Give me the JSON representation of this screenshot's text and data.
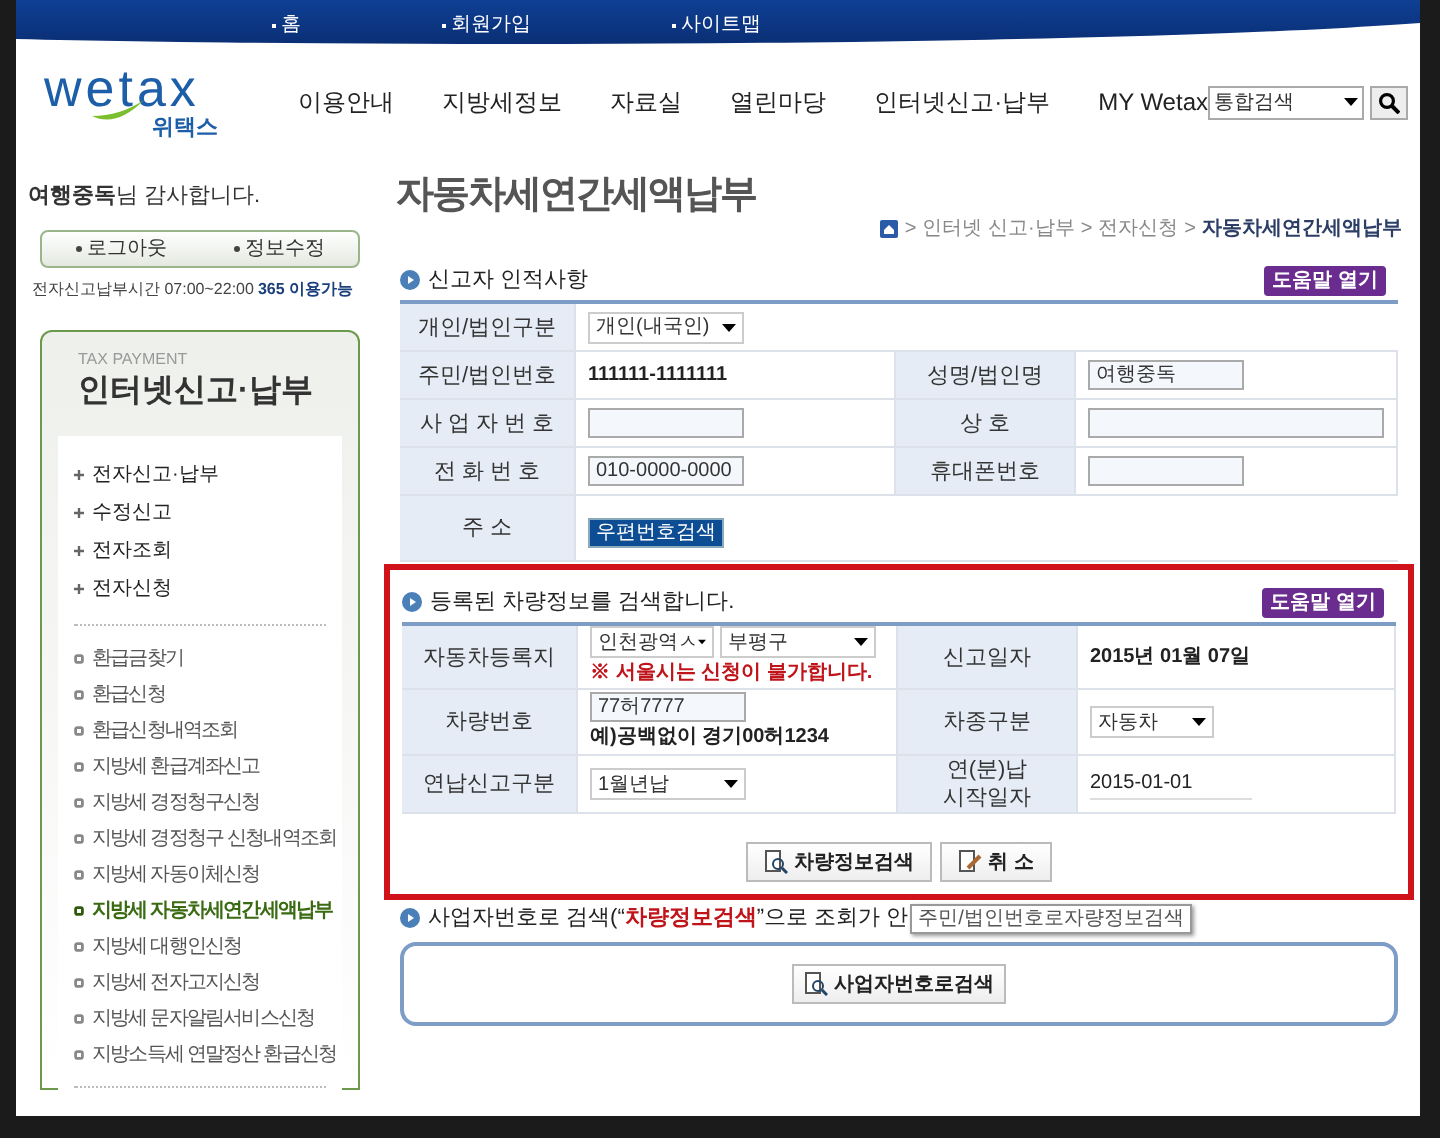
{
  "top_links": [
    "홈",
    "회원가입",
    "사이트맵"
  ],
  "logo": {
    "text": "wetax",
    "subtitle": "위택스"
  },
  "nav": [
    "이용안내",
    "지방세정보",
    "자료실",
    "열린마당",
    "인터넷신고·납부",
    "MY Wetax"
  ],
  "search": {
    "scope": "통합검색"
  },
  "user": {
    "greeting": "**여행중독**님 감사합니다.",
    "buttons": [
      "로그아웃",
      "정보수정"
    ],
    "hours": "전자신고납부시간 07:00~22:00",
    "hours_note": "365 이용가능"
  },
  "sidebar": {
    "eyebrow": "TAX PAYMENT",
    "title": "인터넷신고·납부",
    "groups": [
      "전자신고·납부",
      "수정신고",
      "전자조회",
      "전자신청"
    ],
    "items": [
      {
        "label": "환급금찾기",
        "selected": false
      },
      {
        "label": "환급신청",
        "selected": false
      },
      {
        "label": "환급신청내역조회",
        "selected": false
      },
      {
        "label": "지방세 환급계좌신고",
        "selected": false
      },
      {
        "label": "지방세 경정청구신청",
        "selected": false
      },
      {
        "label": "지방세 경정청구 신청내역조회",
        "selected": false
      },
      {
        "label": "지방세 자동이체신청",
        "selected": false
      },
      {
        "label": "지방세 자동차세연간세액납부",
        "selected": true
      },
      {
        "label": "지방세 대행인신청",
        "selected": false
      },
      {
        "label": "지방세 전자고지신청",
        "selected": false
      },
      {
        "label": "지방세 문자알림서비스신청",
        "selected": false
      },
      {
        "label": "지방소득세 연말정산 환급신청",
        "selected": false
      }
    ]
  },
  "page_title": "자동차세연간세액납부",
  "breadcrumb": {
    "separator": ">",
    "items": [
      "인터넷 신고·납부",
      "전자신청",
      "자동차세연간세액납부"
    ]
  },
  "reporter_section": {
    "title": "신고자 인적사항",
    "help": "도움말 열기",
    "rows": [
      [
        {
          "label": "개인/법인구분",
          "fields": [
            {
              "kind": "select",
              "value": "개인(내국인)"
            }
          ]
        }
      ],
      [
        {
          "label": "주민/법인번호",
          "fields": [
            {
              "kind": "text",
              "value": "111111-1111111"
            }
          ]
        },
        {
          "label": "성명/법인명",
          "fields": [
            {
              "kind": "input",
              "value": "여행중독"
            }
          ]
        }
      ],
      [
        {
          "label": "사 업 자 번 호",
          "fields": [
            {
              "kind": "input"
            }
          ]
        },
        {
          "label": "상 호",
          "fields": [
            {
              "kind": "input_wide"
            }
          ]
        }
      ],
      [
        {
          "label": "전 화 번 호",
          "fields": [
            {
              "kind": "input",
              "value": "010-0000-0000"
            }
          ]
        },
        {
          "label": "휴대폰번호",
          "fields": [
            {
              "kind": "input"
            }
          ]
        }
      ],
      [
        {
          "label": "주 소",
          "fields": [
            {
              "kind": "button",
              "value": "우편번호검색"
            }
          ]
        }
      ]
    ]
  },
  "vehicle_section": {
    "title": "등록된 차량정보를 검색합니다.",
    "help": "도움말 열기",
    "rows": [
      [
        {
          "label": "자동차등록지",
          "fields": [
            {
              "kind": "select_small",
              "value": "인천광역ㅅ"
            },
            {
              "kind": "select",
              "value": "부평구"
            },
            {
              "kind": "warning",
              "value": "※ 서울시는 신청이 불가합니다."
            }
          ]
        },
        {
          "label": "신고일자",
          "fields": [
            {
              "kind": "text",
              "value": "2015년 01월 07일"
            }
          ]
        }
      ],
      [
        {
          "label": "차량번호",
          "fields": [
            {
              "kind": "input",
              "value": "77허7777"
            },
            {
              "kind": "hint",
              "value": "예)공백없이 경기00허1234"
            }
          ]
        },
        {
          "label": "차종구분",
          "fields": [
            {
              "kind": "select_small",
              "value": "자동차"
            }
          ]
        }
      ],
      [
        {
          "label": "연납신고구분",
          "fields": [
            {
              "kind": "select",
              "value": "1월년납"
            }
          ]
        },
        {
          "label": "연(분)납\n시작일자",
          "fields": [
            {
              "kind": "underlined",
              "value": "2015-01-01"
            }
          ]
        }
      ]
    ],
    "buttons": [
      {
        "kind": "search",
        "label": "차량정보검색"
      },
      {
        "kind": "cancel",
        "label": "취 소"
      }
    ]
  },
  "business_section": {
    "title": "사업자번호로 검색(“**차량정보검색**”으로 조회가 안",
    "tooltip": "주민/법인번호로자량정보검색",
    "button": "사업자번호로검색"
  }
}
